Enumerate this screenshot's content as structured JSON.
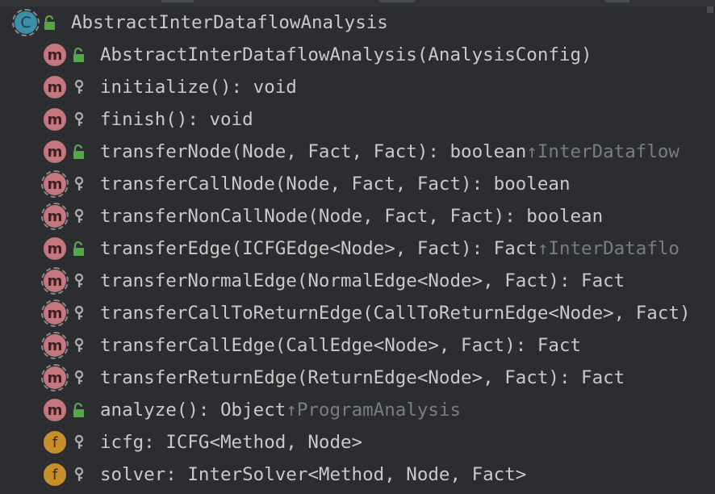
{
  "structure": {
    "rows": [
      {
        "kind": "class",
        "kind_letter": "C",
        "abstract": false,
        "visibility": "public",
        "visibility_icon": "unlock-icon",
        "signature": "AbstractInterDataflowAnalysis",
        "inherited_from": ""
      },
      {
        "kind": "method",
        "kind_letter": "m",
        "abstract": false,
        "visibility": "public",
        "visibility_icon": "unlock-icon",
        "signature": "AbstractInterDataflowAnalysis(AnalysisConfig)",
        "inherited_from": ""
      },
      {
        "kind": "method",
        "kind_letter": "m",
        "abstract": false,
        "visibility": "protected",
        "visibility_icon": "key-icon",
        "signature": "initialize(): void",
        "inherited_from": ""
      },
      {
        "kind": "method",
        "kind_letter": "m",
        "abstract": false,
        "visibility": "protected",
        "visibility_icon": "key-icon",
        "signature": "finish(): void",
        "inherited_from": ""
      },
      {
        "kind": "method",
        "kind_letter": "m",
        "abstract": false,
        "visibility": "public",
        "visibility_icon": "unlock-icon",
        "signature": "transferNode(Node, Fact, Fact): boolean ",
        "inherited_from": "↑InterDataflow"
      },
      {
        "kind": "method",
        "kind_letter": "m",
        "abstract": true,
        "visibility": "protected",
        "visibility_icon": "key-icon",
        "signature": "transferCallNode(Node, Fact, Fact): boolean",
        "inherited_from": ""
      },
      {
        "kind": "method",
        "kind_letter": "m",
        "abstract": true,
        "visibility": "protected",
        "visibility_icon": "key-icon",
        "signature": "transferNonCallNode(Node, Fact, Fact): boolean",
        "inherited_from": ""
      },
      {
        "kind": "method",
        "kind_letter": "m",
        "abstract": false,
        "visibility": "public",
        "visibility_icon": "unlock-icon",
        "signature": "transferEdge(ICFGEdge<Node>, Fact): Fact ",
        "inherited_from": "↑InterDataflo"
      },
      {
        "kind": "method",
        "kind_letter": "m",
        "abstract": true,
        "visibility": "protected",
        "visibility_icon": "key-icon",
        "signature": "transferNormalEdge(NormalEdge<Node>, Fact): Fact",
        "inherited_from": ""
      },
      {
        "kind": "method",
        "kind_letter": "m",
        "abstract": true,
        "visibility": "protected",
        "visibility_icon": "key-icon",
        "signature": "transferCallToReturnEdge(CallToReturnEdge<Node>, Fact)",
        "inherited_from": ""
      },
      {
        "kind": "method",
        "kind_letter": "m",
        "abstract": true,
        "visibility": "protected",
        "visibility_icon": "key-icon",
        "signature": "transferCallEdge(CallEdge<Node>, Fact): Fact",
        "inherited_from": ""
      },
      {
        "kind": "method",
        "kind_letter": "m",
        "abstract": true,
        "visibility": "protected",
        "visibility_icon": "key-icon",
        "signature": "transferReturnEdge(ReturnEdge<Node>, Fact): Fact",
        "inherited_from": ""
      },
      {
        "kind": "method",
        "kind_letter": "m",
        "abstract": false,
        "visibility": "public",
        "visibility_icon": "unlock-icon",
        "signature": "analyze(): Object ",
        "inherited_from": "↑ProgramAnalysis"
      },
      {
        "kind": "field",
        "kind_letter": "f",
        "abstract": false,
        "visibility": "protected",
        "visibility_icon": "key-icon",
        "signature": "icfg: ICFG<Method, Node>",
        "inherited_from": ""
      },
      {
        "kind": "field",
        "kind_letter": "f",
        "abstract": false,
        "visibility": "protected",
        "visibility_icon": "key-icon",
        "signature": "solver: InterSolver<Method, Node, Fact>",
        "inherited_from": ""
      }
    ]
  },
  "colors": {
    "background": "#2b2d30",
    "text": "#c9c9c9",
    "inherited_text": "#7a7d80",
    "class_badge": "#3c8fa8",
    "method_badge": "#c5777f",
    "field_badge": "#c98e2c",
    "public_lock": "#57a64a",
    "protected_key": "#a9a9a9"
  }
}
